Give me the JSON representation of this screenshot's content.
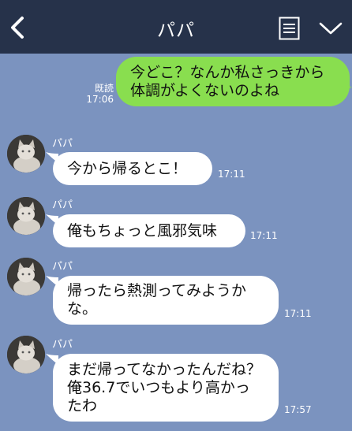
{
  "header": {
    "title": "パパ"
  },
  "outgoing": {
    "text": "今どこ？なんか私さっきから体調がよくないのよね",
    "read": "既読",
    "time": "17:06"
  },
  "messages": [
    {
      "sender": "パパ",
      "text": "今から帰るとこ！",
      "time": "17:11"
    },
    {
      "sender": "パパ",
      "text": "俺もちょっと風邪気味",
      "time": "17:11"
    },
    {
      "sender": "パパ",
      "text": "帰ったら熱測ってみようかな。",
      "time": "17:11"
    },
    {
      "sender": "パパ",
      "text": "まだ帰ってなかったんだね？俺36.7でいつもより高かったわ",
      "time": "17:57"
    }
  ],
  "colors": {
    "header": "#26324a",
    "background": "#7b93bf",
    "outgoing_bubble": "#89de4f",
    "incoming_bubble": "#ffffff"
  },
  "icons": {
    "back": "chevron-left-icon",
    "notes": "notes-icon",
    "menu": "chevron-down-icon",
    "avatar": "cat-avatar"
  }
}
